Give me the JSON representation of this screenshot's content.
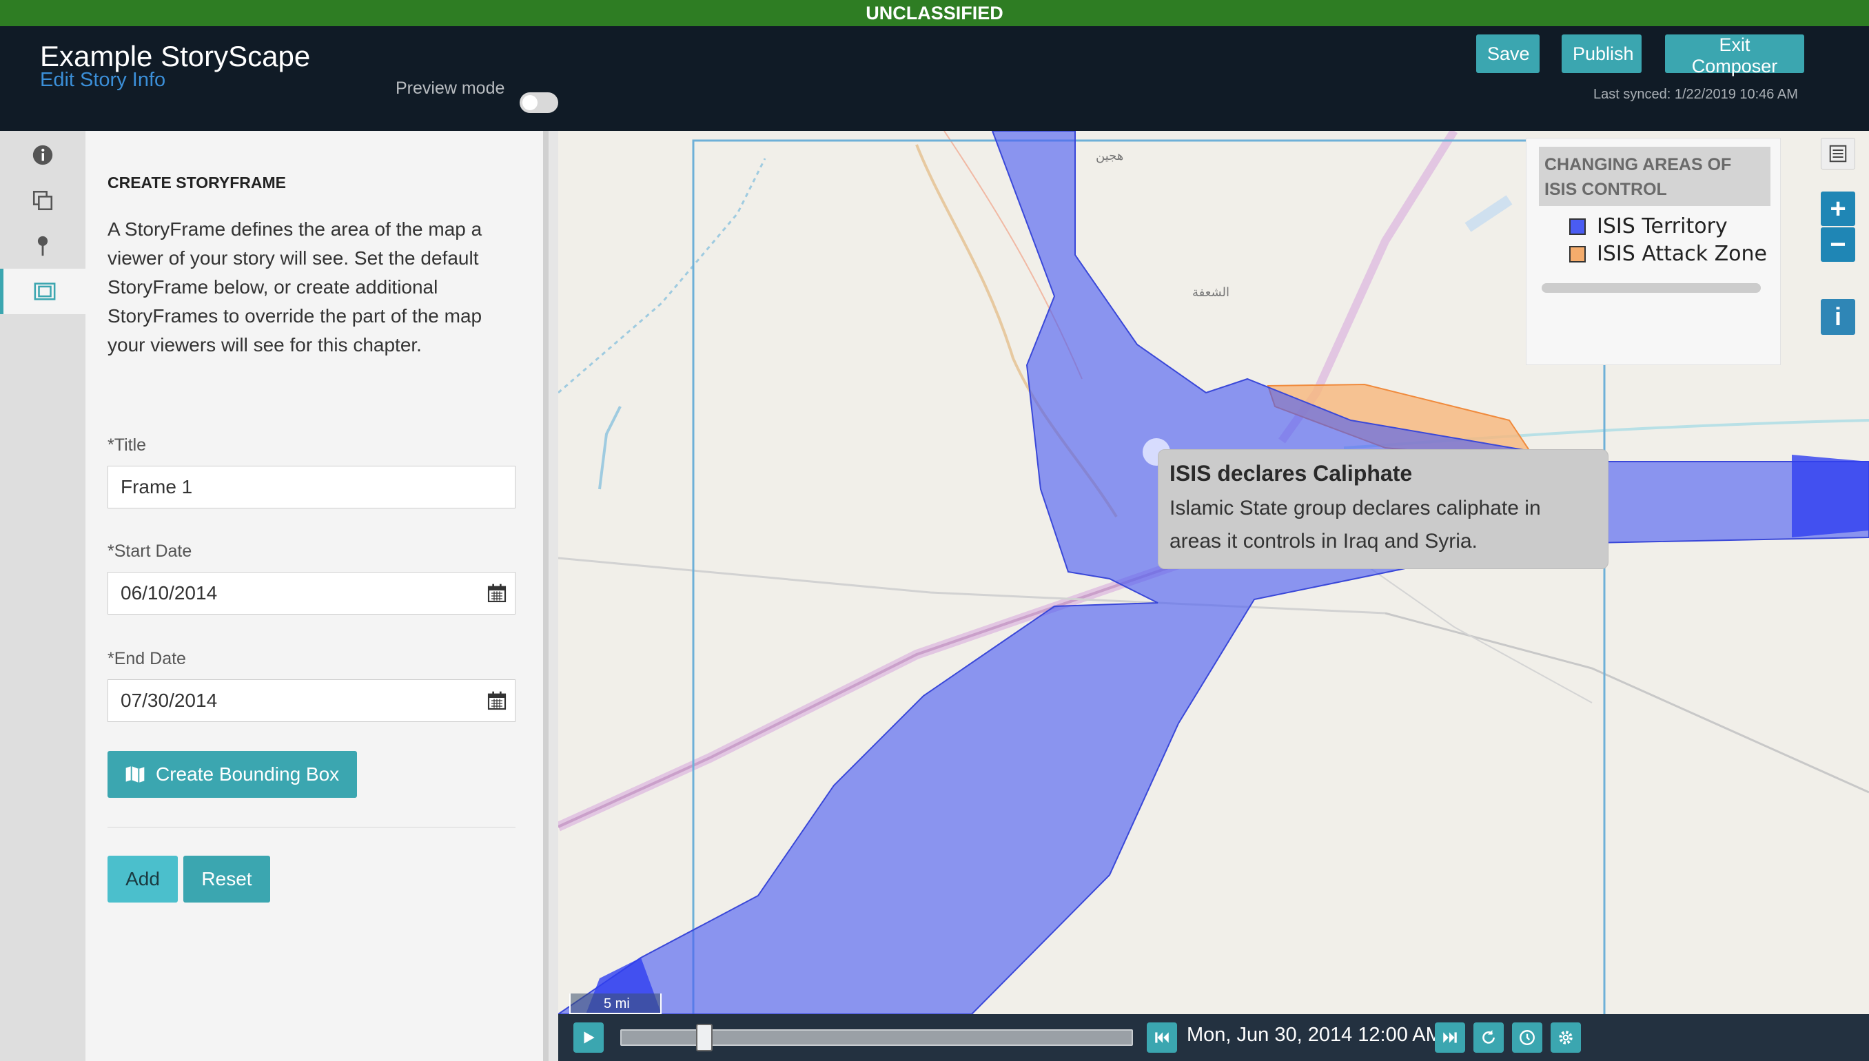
{
  "banner": {
    "text": "UNCLASSIFIED",
    "color": "#2e7d23"
  },
  "header": {
    "title": "Example StoryScape",
    "edit_link": "Edit Story Info",
    "preview_label": "Preview mode",
    "preview_enabled": false,
    "buttons": {
      "save": "Save",
      "publish": "Publish",
      "exit": "Exit Composer"
    },
    "last_synced": "Last synced: 1/22/2019 10:46 AM"
  },
  "rail": {
    "items": [
      {
        "icon": "info-icon"
      },
      {
        "icon": "copy-icon"
      },
      {
        "icon": "map-pin-icon"
      },
      {
        "icon": "storyframe-icon",
        "active": true
      }
    ]
  },
  "panel": {
    "heading": "CREATE STORYFRAME",
    "description": "A StoryFrame defines the area of the map a viewer of your story will see. Set the default StoryFrame below, or create additional StoryFrames to override the part of the map your viewers will see for this chapter.",
    "title_label": "*Title",
    "title_value": "Frame 1",
    "start_label": "*Start Date",
    "start_value": "06/10/2014",
    "end_label": "*End Date",
    "end_value": "07/30/2014",
    "bbox_button": "Create Bounding Box",
    "add_button": "Add",
    "reset_button": "Reset"
  },
  "map": {
    "legend": {
      "title": "CHANGING AREAS OF ISIS CONTROL",
      "items": [
        {
          "label": "ISIS Territory",
          "color": "#4a5cf2"
        },
        {
          "label": "ISIS Attack Zone",
          "color": "#f4ac6c"
        }
      ]
    },
    "place_labels": [
      "هجين",
      "الشعفة"
    ],
    "popup": {
      "title": "ISIS declares Caliphate",
      "body": "Islamic State group declares caliphate in areas it controls in Iraq and Syria."
    },
    "scale": "5 mi",
    "controls": {
      "zoom_in": "+",
      "zoom_out": "−",
      "info": "i"
    }
  },
  "timeline": {
    "date": "Mon, Jun 30, 2014 12:00 AM",
    "position": 0.15
  },
  "colors": {
    "accent": "#3ba6b0",
    "header_bg": "#101b26",
    "timeline_bg": "#233140"
  }
}
